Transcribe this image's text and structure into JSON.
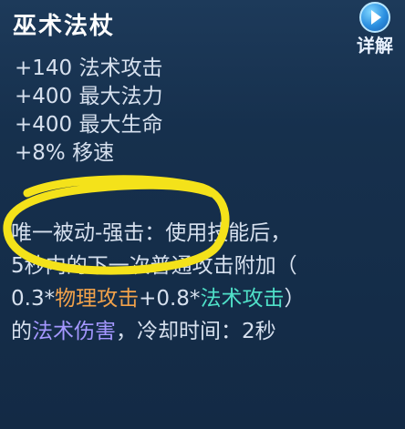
{
  "item": {
    "name": "巫术法杖",
    "detail_label": "详解",
    "stats": [
      "+140 法术攻击",
      "+400 最大法力",
      "+400 最大生命",
      "+8% 移速"
    ],
    "passive": {
      "line1": "唯一被动-强击：使用技能后，",
      "line2": "5秒内的下一次普通攻击附加（",
      "line3_a": "0.3*",
      "line3_phys": "物理攻击",
      "line3_b": "+0.8*",
      "line3_magic": "法术攻击",
      "line3_c": "）",
      "line4_a": "的",
      "line4_magic_damage": "法术伤害",
      "line4_b": "，冷却时间：2秒"
    }
  },
  "colors": {
    "physical": "#f2a24a",
    "magic_attack": "#4fe0c8",
    "magic_damage": "#a497ff",
    "highlight_circle": "#f4e21a"
  },
  "icons": {
    "detail": "play-icon"
  }
}
